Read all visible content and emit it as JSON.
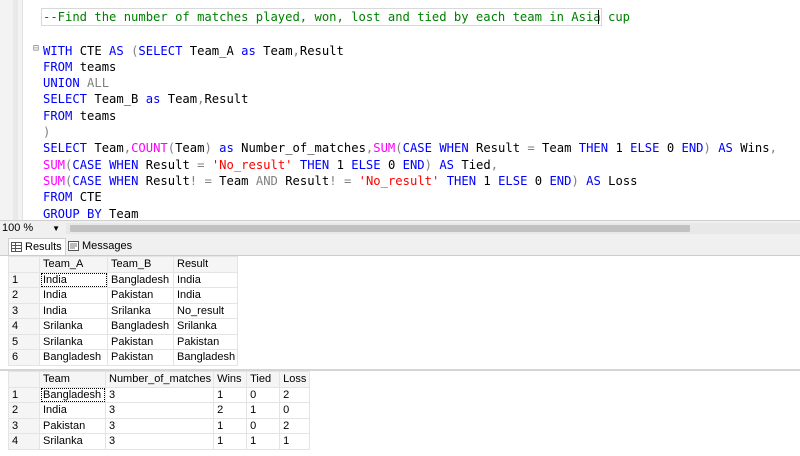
{
  "editor": {
    "lines": [
      [
        {
          "t": "--Find the number of matches played, won, lost and tied by each team in Asia cup",
          "c": "cmt"
        }
      ],
      [],
      [
        {
          "t": "WITH",
          "c": "kw"
        },
        {
          "t": " CTE "
        },
        {
          "t": "AS",
          "c": "kw"
        },
        {
          "t": " ",
          "c": ""
        },
        {
          "t": "(",
          "c": "gray"
        },
        {
          "t": "SELECT",
          "c": "kw"
        },
        {
          "t": " Team_A "
        },
        {
          "t": "as",
          "c": "kw"
        },
        {
          "t": " Team"
        },
        {
          "t": ",",
          "c": "gray"
        },
        {
          "t": "Result"
        }
      ],
      [
        {
          "t": "FROM",
          "c": "kw"
        },
        {
          "t": " teams"
        }
      ],
      [
        {
          "t": "UNION",
          "c": "kw"
        },
        {
          "t": " "
        },
        {
          "t": "ALL",
          "c": "gray"
        }
      ],
      [
        {
          "t": "SELECT",
          "c": "kw"
        },
        {
          "t": " Team_B "
        },
        {
          "t": "as",
          "c": "kw"
        },
        {
          "t": " Team"
        },
        {
          "t": ",",
          "c": "gray"
        },
        {
          "t": "Result"
        }
      ],
      [
        {
          "t": "FROM",
          "c": "kw"
        },
        {
          "t": " teams"
        }
      ],
      [
        {
          "t": ")",
          "c": "gray"
        }
      ],
      [
        {
          "t": "SELECT",
          "c": "kw"
        },
        {
          "t": " Team"
        },
        {
          "t": ",",
          "c": "gray"
        },
        {
          "t": "COUNT",
          "c": "fn"
        },
        {
          "t": "(",
          "c": "gray"
        },
        {
          "t": "Team"
        },
        {
          "t": ")",
          "c": "gray"
        },
        {
          "t": " "
        },
        {
          "t": "as",
          "c": "kw"
        },
        {
          "t": " Number_of_matches"
        },
        {
          "t": ",",
          "c": "gray"
        },
        {
          "t": "SUM",
          "c": "fn"
        },
        {
          "t": "(",
          "c": "gray"
        },
        {
          "t": "CASE",
          "c": "kw"
        },
        {
          "t": " "
        },
        {
          "t": "WHEN",
          "c": "kw"
        },
        {
          "t": " Result "
        },
        {
          "t": "=",
          "c": "gray"
        },
        {
          "t": " Team "
        },
        {
          "t": "THEN",
          "c": "kw"
        },
        {
          "t": " 1 "
        },
        {
          "t": "ELSE",
          "c": "kw"
        },
        {
          "t": " 0 "
        },
        {
          "t": "END",
          "c": "kw"
        },
        {
          "t": ")",
          "c": "gray"
        },
        {
          "t": " "
        },
        {
          "t": "AS",
          "c": "kw"
        },
        {
          "t": " Wins"
        },
        {
          "t": ",",
          "c": "gray"
        }
      ],
      [
        {
          "t": "SUM",
          "c": "fn"
        },
        {
          "t": "(",
          "c": "gray"
        },
        {
          "t": "CASE",
          "c": "kw"
        },
        {
          "t": " "
        },
        {
          "t": "WHEN",
          "c": "kw"
        },
        {
          "t": " Result "
        },
        {
          "t": "=",
          "c": "gray"
        },
        {
          "t": " "
        },
        {
          "t": "'No_result'",
          "c": "str"
        },
        {
          "t": " "
        },
        {
          "t": "THEN",
          "c": "kw"
        },
        {
          "t": " 1 "
        },
        {
          "t": "ELSE",
          "c": "kw"
        },
        {
          "t": " 0 "
        },
        {
          "t": "END",
          "c": "kw"
        },
        {
          "t": ")",
          "c": "gray"
        },
        {
          "t": " "
        },
        {
          "t": "AS",
          "c": "kw"
        },
        {
          "t": " Tied"
        },
        {
          "t": ",",
          "c": "gray"
        }
      ],
      [
        {
          "t": "SUM",
          "c": "fn"
        },
        {
          "t": "(",
          "c": "gray"
        },
        {
          "t": "CASE",
          "c": "kw"
        },
        {
          "t": " "
        },
        {
          "t": "WHEN",
          "c": "kw"
        },
        {
          "t": " Result"
        },
        {
          "t": "!",
          "c": "gray"
        },
        {
          "t": " "
        },
        {
          "t": "=",
          "c": "gray"
        },
        {
          "t": " Team "
        },
        {
          "t": "AND",
          "c": "gray"
        },
        {
          "t": " Result"
        },
        {
          "t": "!",
          "c": "gray"
        },
        {
          "t": " "
        },
        {
          "t": "=",
          "c": "gray"
        },
        {
          "t": " "
        },
        {
          "t": "'No_result'",
          "c": "str"
        },
        {
          "t": " "
        },
        {
          "t": "THEN",
          "c": "kw"
        },
        {
          "t": " 1 "
        },
        {
          "t": "ELSE",
          "c": "kw"
        },
        {
          "t": " 0 "
        },
        {
          "t": "END",
          "c": "kw"
        },
        {
          "t": ")",
          "c": "gray"
        },
        {
          "t": " "
        },
        {
          "t": "AS",
          "c": "kw"
        },
        {
          "t": " Loss"
        }
      ],
      [
        {
          "t": "FROM",
          "c": "kw"
        },
        {
          "t": " CTE"
        }
      ],
      [
        {
          "t": "GROUP",
          "c": "kw"
        },
        {
          "t": " "
        },
        {
          "t": "BY",
          "c": "kw"
        },
        {
          "t": " Team"
        }
      ]
    ]
  },
  "zoom": {
    "value": "100 %"
  },
  "tabs": {
    "results": "Results",
    "messages": "Messages"
  },
  "grid1": {
    "headers": [
      "Team_A",
      "Team_B",
      "Result"
    ],
    "rows": [
      {
        "n": "1",
        "cells": [
          "India",
          "Bangladesh",
          "India"
        ]
      },
      {
        "n": "2",
        "cells": [
          "India",
          "Pakistan",
          "India"
        ]
      },
      {
        "n": "3",
        "cells": [
          "India",
          "Srilanka",
          "No_result"
        ]
      },
      {
        "n": "4",
        "cells": [
          "Srilanka",
          "Bangladesh",
          "Srilanka"
        ]
      },
      {
        "n": "5",
        "cells": [
          "Srilanka",
          "Pakistan",
          "Pakistan"
        ]
      },
      {
        "n": "6",
        "cells": [
          "Bangladesh",
          "Pakistan",
          "Bangladesh"
        ]
      }
    ]
  },
  "grid2": {
    "headers": [
      "Team",
      "Number_of_matches",
      "Wins",
      "Tied",
      "Loss"
    ],
    "rows": [
      {
        "n": "1",
        "cells": [
          "Bangladesh",
          "3",
          "1",
          "0",
          "2"
        ]
      },
      {
        "n": "2",
        "cells": [
          "India",
          "3",
          "2",
          "1",
          "0"
        ]
      },
      {
        "n": "3",
        "cells": [
          "Pakistan",
          "3",
          "1",
          "0",
          "2"
        ]
      },
      {
        "n": "4",
        "cells": [
          "Srilanka",
          "3",
          "1",
          "1",
          "1"
        ]
      }
    ]
  }
}
